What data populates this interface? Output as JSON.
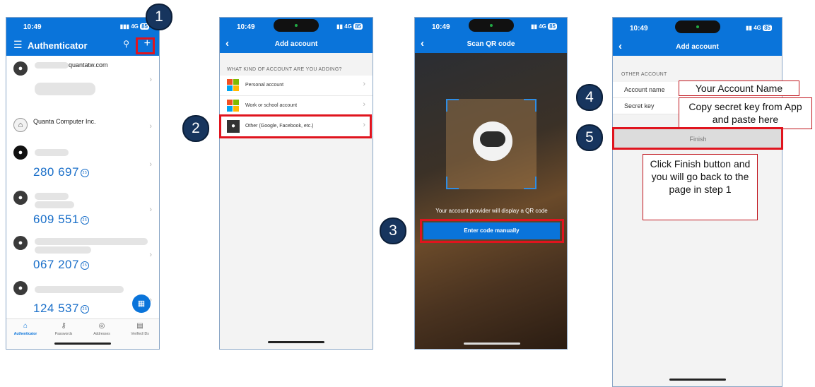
{
  "status": {
    "time": "10:49",
    "signal": "4G",
    "battery": "85"
  },
  "screen1": {
    "title": "Authenticator",
    "accounts": [
      {
        "name": "quantatw.com",
        "code": ""
      },
      {
        "name": "Quanta Computer Inc.",
        "code": ""
      },
      {
        "name": "",
        "code": "280 697"
      },
      {
        "name": "",
        "code": "609 551"
      },
      {
        "name": "",
        "code": "067 207"
      },
      {
        "name": "",
        "code": "124 537"
      }
    ],
    "timer": "25",
    "tabs": [
      "Authenticator",
      "Passwords",
      "Addresses",
      "Verified IDs"
    ]
  },
  "screen2": {
    "title": "Add account",
    "section": "WHAT KIND OF ACCOUNT ARE YOU ADDING?",
    "options": [
      "Personal account",
      "Work or school account",
      "Other (Google, Facebook, etc.)"
    ]
  },
  "screen3": {
    "title": "Scan QR code",
    "hint": "Your account provider will display a QR code",
    "button": "Enter code manually"
  },
  "screen4": {
    "title": "Add account",
    "section": "OTHER ACCOUNT",
    "account_name_label": "Account name",
    "secret_key_label": "Secret key",
    "finish": "Finish"
  },
  "callouts": {
    "step1": "1",
    "step2": "2",
    "step3": "3",
    "step4": "4",
    "step5": "5",
    "account_name_note": "Your Account Name",
    "secret_note": "Copy secret key from App and paste here",
    "finish_note": "Click Finish button and you will go back to the page in step 1"
  },
  "colors": {
    "accent": "#0a74da",
    "highlight": "#e0141e",
    "callout": "#17355e"
  }
}
